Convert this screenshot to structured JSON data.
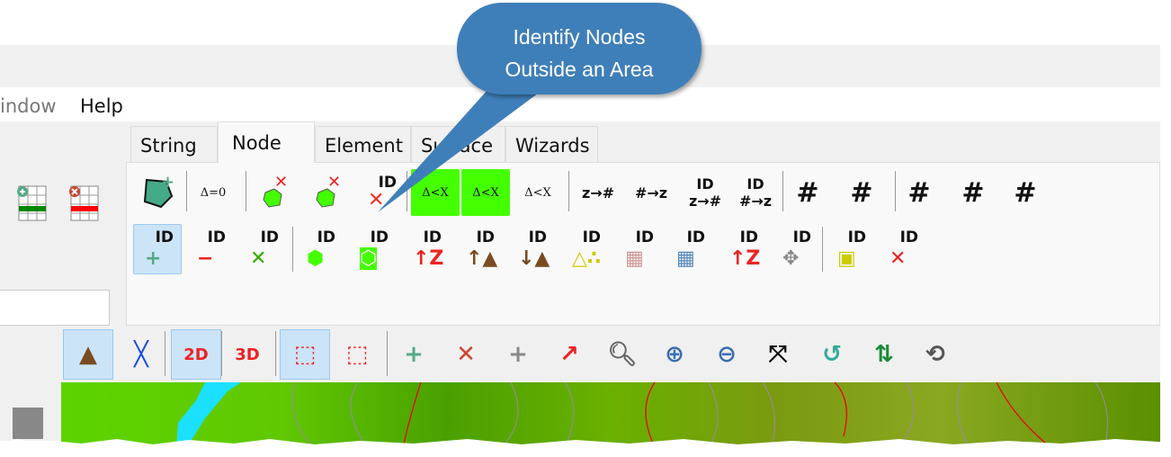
{
  "callout": {
    "line1": "Identify Nodes",
    "line2": "Outside an Area",
    "color": "#3f7fb9"
  },
  "menu": {
    "window": "indow",
    "help": "Help"
  },
  "tabs": [
    {
      "label": "String"
    },
    {
      "label": "Node",
      "active": true
    },
    {
      "label": "Element"
    },
    {
      "label": "Surface"
    },
    {
      "label": "Wizards"
    }
  ],
  "left_icons": [
    {
      "icon": "table-add-row-icon"
    },
    {
      "icon": "table-delete-row-icon"
    }
  ],
  "ribbon_row1": [
    {
      "icon": "polygon-add-nodes-icon"
    },
    {
      "icon": "delta-zero-icon",
      "text": "Δ=0"
    },
    {
      "icon": "delete-nodes-in-polygon-icon"
    },
    {
      "icon": "delete-nodes-outside-polygon-icon"
    },
    {
      "icon": "delete-id-icon",
      "text": "ID"
    },
    {
      "icon": "delta-x-inside-icon",
      "text": "Δ<X"
    },
    {
      "icon": "delta-x-outside-icon",
      "text": "Δ<X"
    },
    {
      "icon": "delta-x-icon",
      "text": "Δ<X"
    },
    {
      "icon": "z-to-number-icon",
      "text": "z→#"
    },
    {
      "icon": "number-to-z-icon",
      "text": "#→z"
    },
    {
      "icon": "copy-id-z-to-number-icon",
      "text": "ID",
      "sub": "z→#"
    },
    {
      "icon": "paste-id-number-to-z-icon",
      "text": "ID",
      "sub": "#→z"
    },
    {
      "icon": "clear-number-icon",
      "text": "#"
    },
    {
      "icon": "clear-number-elements-icon",
      "text": "#"
    },
    {
      "icon": "number-colors-icon",
      "text": "#"
    },
    {
      "icon": "number-colors-settings-icon",
      "text": "#"
    },
    {
      "icon": "number-settings-icon",
      "text": "#"
    }
  ],
  "ribbon_row2": [
    {
      "icon": "add-node-id-icon",
      "text": "ID",
      "active": true
    },
    {
      "icon": "remove-node-id-icon",
      "text": "ID"
    },
    {
      "icon": "delete-node-id-icon",
      "text": "ID"
    },
    {
      "icon": "id-nodes-in-area-icon",
      "text": "ID"
    },
    {
      "icon": "id-nodes-outside-area-icon",
      "text": "ID"
    },
    {
      "icon": "id-raise-z-icon",
      "text": "ID"
    },
    {
      "icon": "id-raise-terrain-icon",
      "text": "ID"
    },
    {
      "icon": "id-lower-terrain-icon",
      "text": "ID"
    },
    {
      "icon": "id-triangle-points-icon",
      "text": "ID"
    },
    {
      "icon": "id-elements-partial-icon",
      "text": "ID"
    },
    {
      "icon": "id-elements-icon",
      "text": "ID"
    },
    {
      "icon": "id-node-z-icon",
      "text": "ID"
    },
    {
      "icon": "id-node-move-icon",
      "text": "ID"
    },
    {
      "icon": "id-element-node-icon",
      "text": "ID"
    },
    {
      "icon": "delete-all-id-icon",
      "text": "ID"
    }
  ],
  "toolbar": [
    {
      "icon": "terrain-icon",
      "active": true
    },
    {
      "icon": "breakline-icon"
    },
    {
      "icon": "view-2d-icon",
      "text": "2D",
      "active": true
    },
    {
      "icon": "view-3d-icon",
      "text": "3D"
    },
    {
      "icon": "box-solid-icon",
      "active": true
    },
    {
      "icon": "box-outline-icon"
    },
    {
      "icon": "add-point-icon",
      "text": "+"
    },
    {
      "icon": "delete-point-icon",
      "text": "✕"
    },
    {
      "icon": "add-point-on-line-icon",
      "text": "+"
    },
    {
      "icon": "draw-line-icon"
    },
    {
      "icon": "zoom-window-icon"
    },
    {
      "icon": "zoom-in-icon"
    },
    {
      "icon": "zoom-out-icon"
    },
    {
      "icon": "zoom-extents-icon"
    },
    {
      "icon": "zoom-previous-icon"
    },
    {
      "icon": "swap-view-icon"
    },
    {
      "icon": "rotate-view-icon"
    }
  ]
}
